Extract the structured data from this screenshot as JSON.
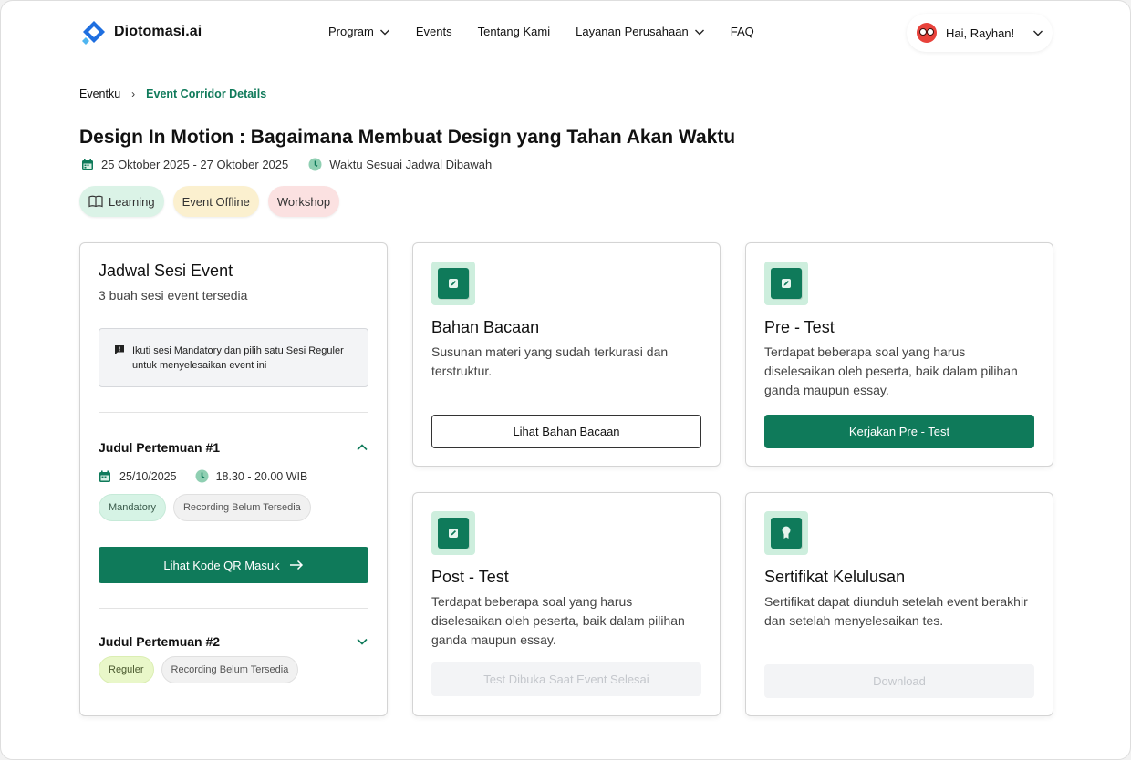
{
  "brand": {
    "name": "Diotomasi.ai"
  },
  "nav": {
    "items": [
      {
        "label": "Program",
        "dropdown": true
      },
      {
        "label": "Events",
        "dropdown": false
      },
      {
        "label": "Tentang Kami",
        "dropdown": false
      },
      {
        "label": "Layanan Perusahaan",
        "dropdown": true
      },
      {
        "label": "FAQ",
        "dropdown": false
      }
    ],
    "user_greeting": "Hai, Rayhan!"
  },
  "breadcrumb": {
    "parent": "Eventku",
    "separator": "›",
    "current": "Event Corridor Details"
  },
  "event": {
    "title": "Design In Motion : Bagaimana Membuat Design yang Tahan Akan Waktu",
    "date_range": "25 Oktober 2025 - 27 Oktober 2025",
    "time_note": "Waktu Sesuai Jadwal Dibawah",
    "tags": [
      "Learning",
      "Event Offline",
      "Workshop"
    ]
  },
  "schedule": {
    "title": "Jadwal Sesi Event",
    "subtitle": "3 buah sesi event tersedia",
    "notice": "Ikuti sesi Mandatory dan pilih satu Sesi Reguler untuk menyelesaikan event ini",
    "sessions": [
      {
        "title": "Judul Pertemuan #1",
        "expanded": true,
        "date": "25/10/2025",
        "time": "18.30 - 20.00 WIB",
        "type": "Mandatory",
        "recording": "Recording Belum Tersedia",
        "qr_button": "Lihat Kode QR Masuk"
      },
      {
        "title": "Judul Pertemuan #2",
        "expanded": false,
        "type": "Reguler",
        "recording": "Recording Belum Tersedia"
      }
    ]
  },
  "features": [
    {
      "title": "Bahan Bacaan",
      "description": "Susunan materi yang sudah terkurasi dan terstruktur.",
      "button": "Lihat Bahan Bacaan",
      "button_state": "outline",
      "icon": "pencil-icon"
    },
    {
      "title": "Pre - Test",
      "description": "Terdapat beberapa soal yang harus diselesaikan oleh peserta, baik dalam pilihan ganda maupun essay.",
      "button": "Kerjakan Pre - Test",
      "button_state": "primary",
      "icon": "pencil-icon"
    },
    {
      "title": "Post - Test",
      "description": "Terdapat beberapa soal yang harus diselesaikan oleh peserta, baik dalam pilihan ganda maupun essay.",
      "button": "Test Dibuka Saat Event Selesai",
      "button_state": "disabled",
      "icon": "pencil-icon"
    },
    {
      "title": "Sertifikat Kelulusan",
      "description": "Sertifikat dapat diunduh setelah event berakhir dan setelah menyelesaikan tes.",
      "button": "Download",
      "button_state": "disabled",
      "icon": "certificate-icon"
    }
  ],
  "colors": {
    "primary": "#0f7a5a",
    "primary_light": "#cdeedd",
    "brand_blue": "#2f6fe4"
  }
}
